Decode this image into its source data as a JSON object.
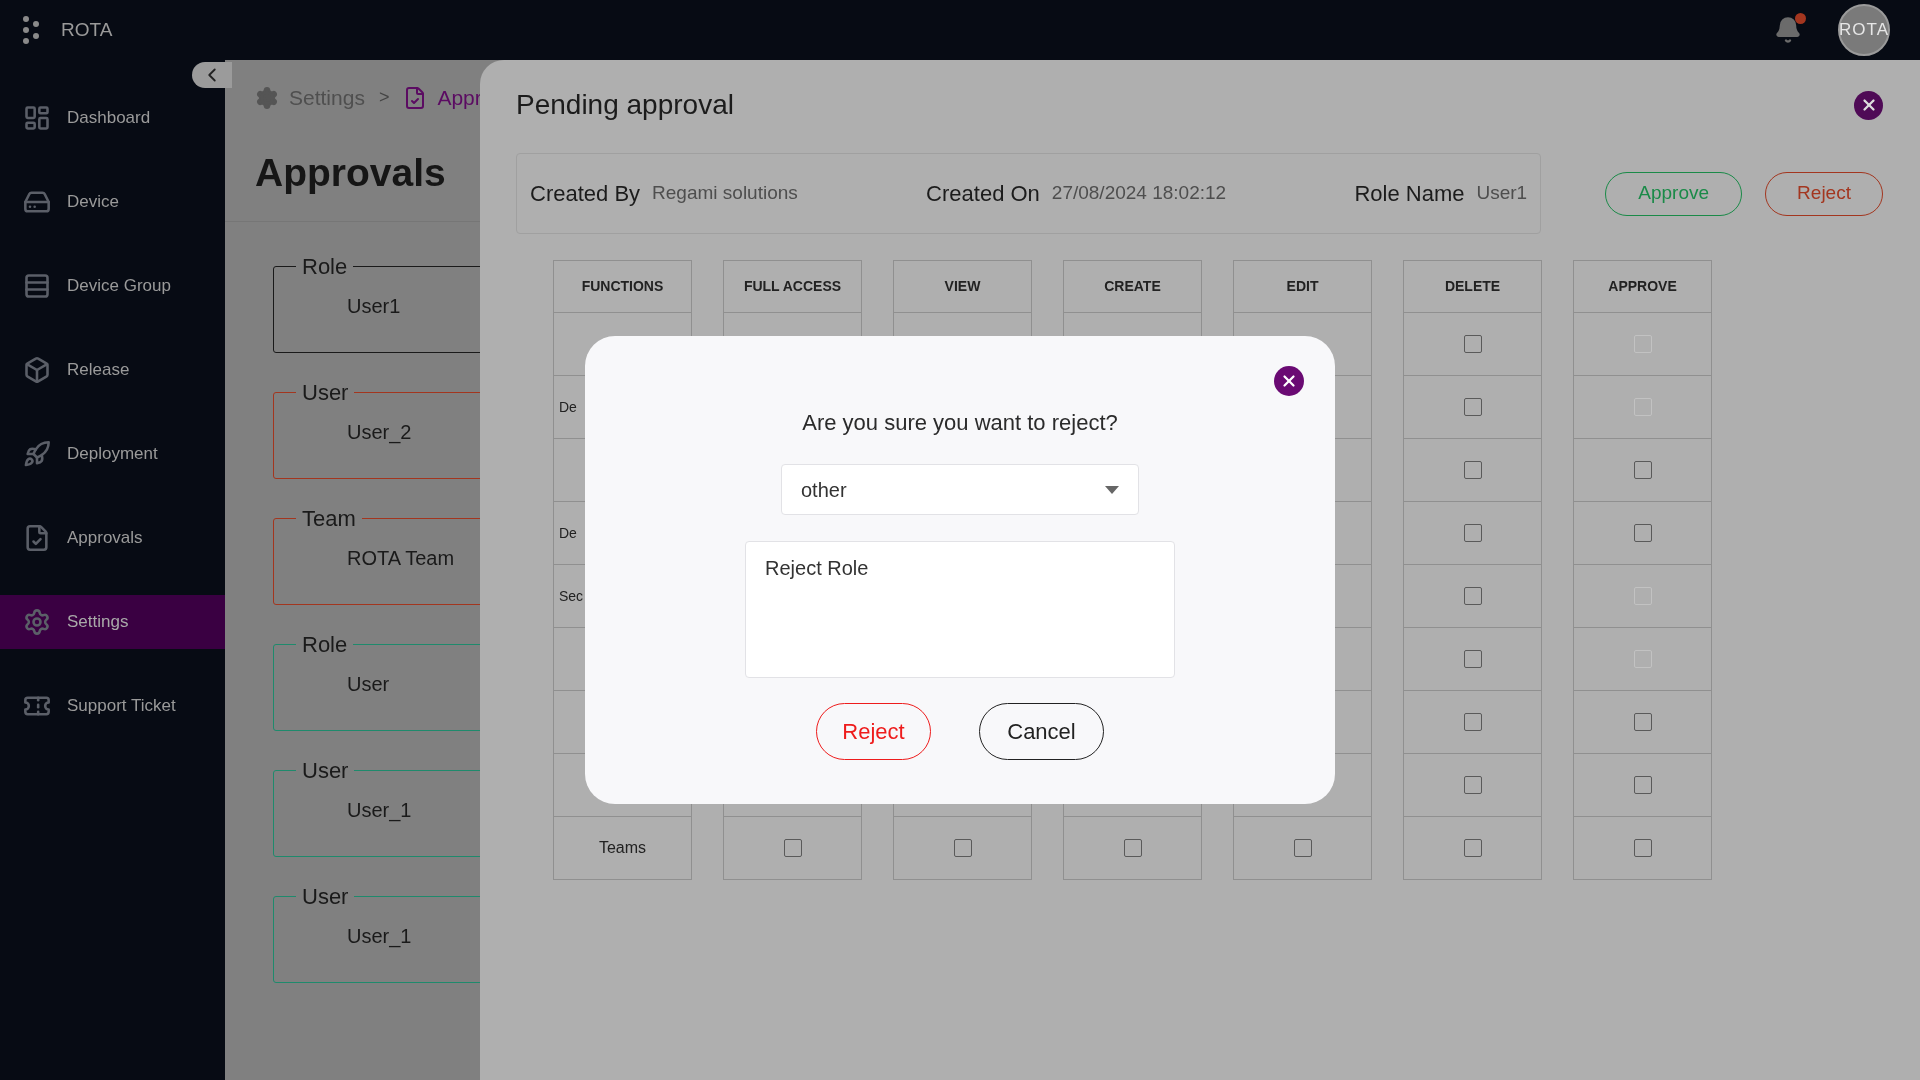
{
  "top_bar": {
    "app_name": "ROTA",
    "notification": {
      "unread": true
    },
    "avatar": "ROTA"
  },
  "sidebar": {
    "items": [
      {
        "label": "Dashboard",
        "selected": false
      },
      {
        "label": "Device",
        "selected": false
      },
      {
        "label": "Device Group",
        "selected": false
      },
      {
        "label": "Release",
        "selected": false
      },
      {
        "label": "Deployment",
        "selected": false
      },
      {
        "label": "Approvals",
        "selected": false
      },
      {
        "label": "Settings",
        "selected": true
      },
      {
        "label": "Support Ticket",
        "selected": false
      }
    ]
  },
  "breadcrumb": [
    {
      "label": "Settings",
      "selected": false
    },
    {
      "label": "Appr",
      "selected": true
    }
  ],
  "breadcrumb_separator": ">",
  "page": {
    "title": "Approvals",
    "cards": [
      {
        "type": "Role",
        "name": "User1",
        "color": "#1a1a1a"
      },
      {
        "type": "User",
        "name": "User_2",
        "color": "#a3361f"
      },
      {
        "type": "Team",
        "name": "ROTA Team",
        "color": "#a3361f"
      },
      {
        "type": "Role",
        "name": "User",
        "color": "#1f8a6c"
      },
      {
        "type": "User",
        "name": "User_1",
        "color": "#1f8a6c"
      },
      {
        "type": "User",
        "name": "User_1",
        "color": "#1f8a6c"
      }
    ]
  },
  "drawer": {
    "title": "Pending approval",
    "info": [
      {
        "label": "Created By",
        "value": "Regami solutions"
      },
      {
        "label": "Created On",
        "value": "27/08/2024 18:02:12"
      },
      {
        "label": "Role Name",
        "value": "User1"
      }
    ],
    "approve_button": "Approve",
    "reject_button": "Reject",
    "table": {
      "columns": [
        "FUNCTIONS",
        "FULL ACCESS",
        "VIEW",
        "CREATE",
        "EDIT",
        "DELETE",
        "APPROVE"
      ],
      "rows": [
        {
          "checkboxes": [
            {
              "checked": false,
              "disabled": false
            },
            {
              "checked": false,
              "disabled": true
            }
          ]
        },
        {
          "function": "De",
          "checkboxes": [
            {
              "checked": false,
              "disabled": false
            },
            {
              "checked": false,
              "disabled": true
            }
          ]
        },
        {
          "checkboxes": [
            {
              "checked": false,
              "disabled": false
            },
            {
              "checked": false,
              "disabled": false
            }
          ]
        },
        {
          "function": "De",
          "checkboxes": [
            {
              "checked": false,
              "disabled": false
            },
            {
              "checked": false,
              "disabled": false
            }
          ]
        },
        {
          "function": "Sec",
          "checkboxes": [
            {
              "checked": false,
              "disabled": false
            },
            {
              "checked": false,
              "disabled": true
            }
          ]
        },
        {
          "checkboxes": [
            {
              "checked": false,
              "disabled": false
            },
            {
              "checked": false,
              "disabled": true
            }
          ]
        },
        {
          "checkboxes": [
            {
              "checked": false,
              "disabled": false
            },
            {
              "checked": false,
              "disabled": false
            }
          ]
        },
        {
          "checkboxes": [
            {
              "checked": false,
              "disabled": false
            },
            {
              "checked": false,
              "disabled": false
            }
          ]
        },
        {
          "function": "Teams",
          "checkboxes": [
            {
              "checked": false,
              "disabled": false
            },
            {
              "checked": false,
              "disabled": false
            },
            {
              "checked": false,
              "disabled": false
            },
            {
              "checked": false,
              "disabled": false
            },
            {
              "checked": false,
              "disabled": false
            },
            {
              "checked": false,
              "disabled": false
            }
          ]
        }
      ]
    }
  },
  "dialog": {
    "question": "Are you sure you want to reject?",
    "reason": "other",
    "comment": "Reject Role",
    "confirm_button": "Reject",
    "cancel_button": "Cancel"
  }
}
